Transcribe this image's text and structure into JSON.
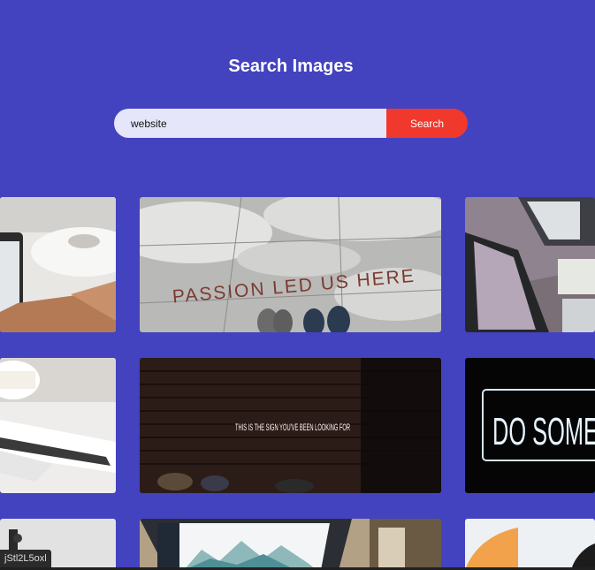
{
  "header": {
    "title": "Search Images"
  },
  "search": {
    "value": "website",
    "button_label": "Search"
  },
  "gallery": {
    "neon_sign_text": "THIS IS THE SIGN YOU'VE BEEN LOOKING FOR",
    "passion_text": "PASSION LED US HERE",
    "do_some_text": "DO SOME"
  },
  "status_bar": {
    "url": "jStl2L5oxl"
  }
}
